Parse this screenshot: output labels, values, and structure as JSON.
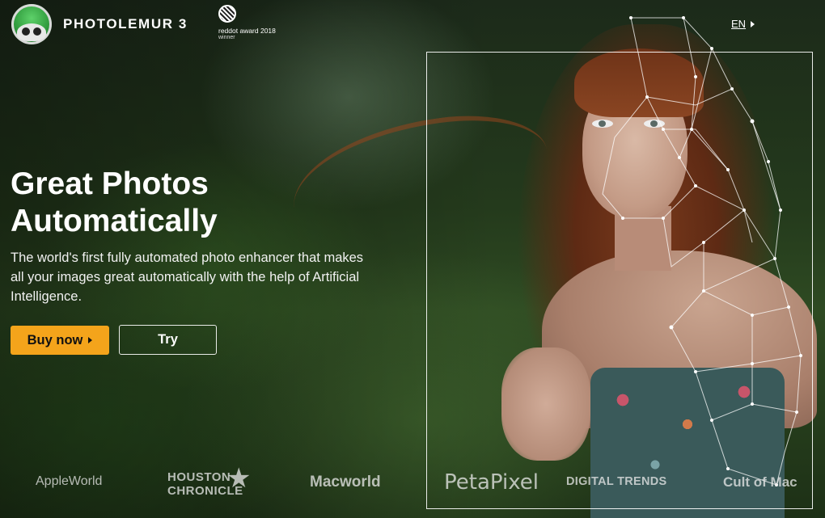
{
  "header": {
    "brand": "PHOTOLEMUR 3",
    "award_line1": "reddot award 2018",
    "award_line2": "winner",
    "language": "EN"
  },
  "hero": {
    "title_line1": "Great Photos",
    "title_line2": "Automatically",
    "description": "The world's first fully automated photo enhancer that makes all your images great automatically with the help of Artificial Intelligence.",
    "buy_label": "Buy now",
    "try_label": "Try"
  },
  "press": {
    "appleworld": "AppleWorld",
    "houston_line1": "HOUSTON",
    "houston_line2": "CHRONICLE",
    "macworld": "Macworld",
    "petapixel": "PetaPixel",
    "digitaltrends": "DIGITAL TRENDS",
    "cultofmac": "Cult of Mac"
  },
  "colors": {
    "accent": "#f4a41b",
    "background": "#243a1c"
  }
}
